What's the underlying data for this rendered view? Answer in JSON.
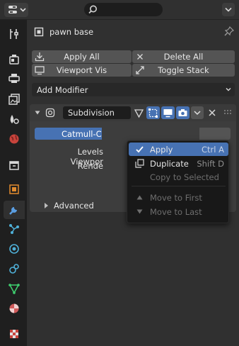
{
  "header": {
    "search_placeholder": ""
  },
  "tabs": [
    {
      "name": "tool-tab",
      "icon": "tool-icon"
    },
    {
      "name": "render-tab",
      "icon": "render-icon"
    },
    {
      "name": "output-tab",
      "icon": "output-icon"
    },
    {
      "name": "view-layer-tab",
      "icon": "view-layer-icon"
    },
    {
      "name": "scene-tab",
      "icon": "scene-icon"
    },
    {
      "name": "world-tab",
      "icon": "world-icon"
    },
    {
      "name": "collection-tab",
      "icon": "collection-icon"
    },
    {
      "name": "object-tab",
      "icon": "object-icon"
    },
    {
      "name": "modifier-tab",
      "icon": "wrench-icon",
      "active": true
    },
    {
      "name": "particles-tab",
      "icon": "particles-icon"
    },
    {
      "name": "physics-tab",
      "icon": "physics-icon"
    },
    {
      "name": "constraints-tab",
      "icon": "constraints-icon"
    },
    {
      "name": "data-tab",
      "icon": "mesh-data-icon"
    },
    {
      "name": "material-tab",
      "icon": "material-icon"
    },
    {
      "name": "texture-tab",
      "icon": "texture-icon"
    }
  ],
  "object": {
    "name": "pawn base"
  },
  "toolbar": {
    "apply_all": "Apply All",
    "delete_all": "Delete All",
    "viewport_vis": "Viewport Vis",
    "toggle_stack": "Toggle Stack"
  },
  "add_modifier": {
    "label": "Add Modifier"
  },
  "modifier": {
    "name": "Subdivision",
    "catmull_label": "Catmull-Cla",
    "levels_viewport_label": "Levels Viewpor",
    "render_label": "Rende",
    "advanced_label": "Advanced"
  },
  "context_menu": {
    "items": [
      {
        "label": "Apply",
        "shortcut": "Ctrl A",
        "highlighted": true,
        "icon": "check-icon"
      },
      {
        "label": "Duplicate",
        "shortcut": "Shift D",
        "icon": "duplicate-icon"
      },
      {
        "label": "Copy to Selected",
        "shortcut": "",
        "disabled": true
      },
      {
        "label": "Move to First",
        "shortcut": "",
        "disabled": true,
        "icon": "triangle-up-icon"
      },
      {
        "label": "Move to Last",
        "shortcut": "",
        "disabled": true,
        "icon": "triangle-down-icon"
      }
    ]
  },
  "colors": {
    "accent": "#4772b3",
    "panel": "#3d3d3d",
    "background": "#303030",
    "button": "#545454",
    "menu": "#181818"
  }
}
